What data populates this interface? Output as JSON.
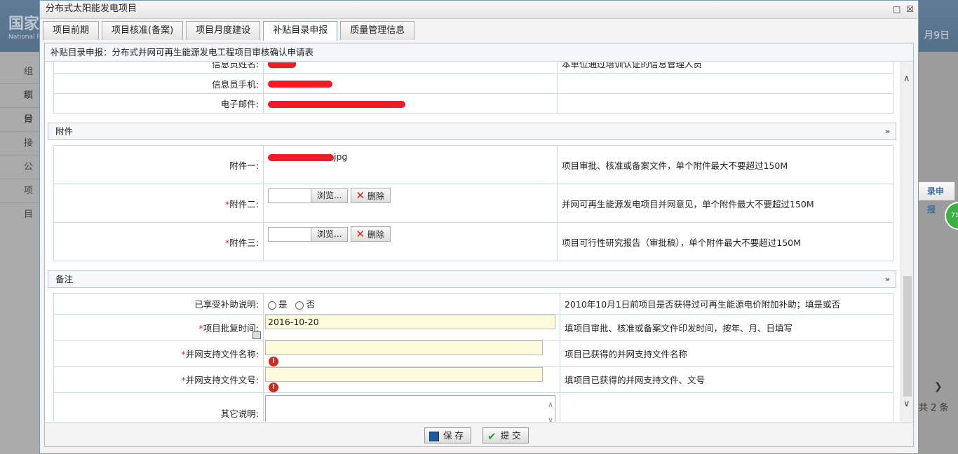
{
  "background": {
    "logo": "国家",
    "logo_small": "National R",
    "date": "月9日",
    "left_items": [
      "组织",
      "项目",
      "分",
      "接",
      "公",
      "项目"
    ],
    "right_tab": "录申报",
    "right_pager": "共 2 条",
    "badge": "71"
  },
  "dialog": {
    "title": "分布式太阳能发电项目",
    "tabs": [
      "项目前期",
      "项目核准(备案)",
      "项目月度建设",
      "补贴目录申报",
      "质量管理信息"
    ],
    "active_tab": "补贴目录申报",
    "content_title": "补贴目录申报：分布式并网可再生能源发电工程项目审核确认申请表"
  },
  "contact_rows": [
    {
      "label": "信息员姓名:",
      "desc": "本单位通过培训认证的信息管理人员"
    },
    {
      "label": "信息员手机:",
      "desc": ""
    },
    {
      "label": "电子邮件:",
      "desc": ""
    }
  ],
  "attachments": {
    "title": "附件",
    "rows": [
      {
        "label": "附件一:",
        "required": false,
        "file": "jpg",
        "desc": "项目审批、核准或备案文件，单个附件最大不要超过150M"
      },
      {
        "label": "附件二:",
        "required": true,
        "desc": "并网可再生能源发电项目并网意见，单个附件最大不要超过150M"
      },
      {
        "label": "附件三:",
        "required": true,
        "desc": "项目可行性研究报告（审批稿），单个附件最大不要超过150M"
      }
    ],
    "browse_label": "浏览...",
    "delete_label": "删除"
  },
  "remarks": {
    "title": "备注",
    "subsidy": {
      "label": "已享受补助说明:",
      "opt_yes": "是",
      "opt_no": "否",
      "desc": "2010年10月1日前项目是否获得过可再生能源电价附加补助；填是或否"
    },
    "approval_date": {
      "label": "项目批复时间:",
      "value": "2016-10-20",
      "desc": "填项目审批、核准或备案文件印发时间，按年、月、日填写"
    },
    "grid_doc_name": {
      "label": "并网支持文件名称:",
      "value": "",
      "desc": "项目已获得的并网支持文件名称"
    },
    "grid_doc_no": {
      "label": "并网支持文件文号:",
      "value": "",
      "desc": "填项目已获得的并网支持文件、文号"
    },
    "other": {
      "label": "其它说明:",
      "value": "",
      "desc": ""
    }
  },
  "footer": {
    "save": "保 存",
    "submit": "提 交"
  }
}
